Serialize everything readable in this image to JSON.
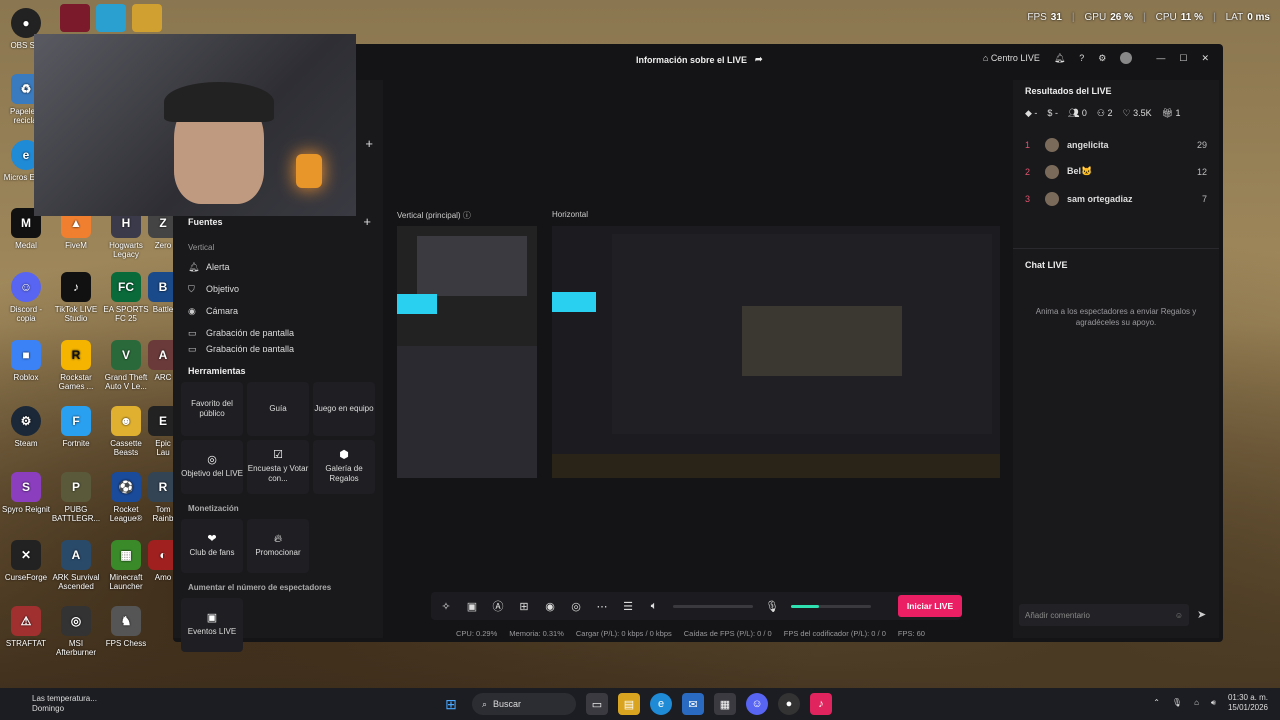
{
  "hud": {
    "fps_label": "FPS",
    "fps": "31",
    "gpu_label": "GPU",
    "gpu": "26 %",
    "cpu_label": "CPU",
    "cpu": "11 %",
    "lat_label": "LAT",
    "lat": "0 ms"
  },
  "desktop": {
    "icons": [
      "OBS Stu",
      "Papelera reciclaj",
      "Micros Edge",
      "Medal",
      "Discord - copia",
      "Roblox",
      "Steam",
      "Spyro Reignit",
      "CurseForge",
      "STRAFTAT",
      "FiveM",
      "TikTok LIVE Studio",
      "Rockstar Games ...",
      "Fortnite",
      "PUBG BATTLEGR...",
      "ARK Survival Ascended",
      "MSI Afterburner",
      "Hogwarts Legacy",
      "EA SPORTS FC 25",
      "Grand Theft Auto V Le...",
      "Cassette Beasts",
      "Rocket League®",
      "Minecraft Launcher",
      "FPS Chess",
      "Zero",
      "Battle",
      "ARC",
      "Epic Lau",
      "Tom Rainb",
      "Amo"
    ]
  },
  "window": {
    "title": "Información sobre el LIVE",
    "centro": "Centro LIVE"
  },
  "left": {
    "sources_title": "Fuentes",
    "vertical_label": "Vertical",
    "sources": [
      "Alerta",
      "Objetivo",
      "Cámara",
      "Grabación de pantalla",
      "Grabación de pantalla"
    ],
    "tools_title": "Herramientas",
    "tools": [
      {
        "label": "Favorito del público"
      },
      {
        "label": "Guía"
      },
      {
        "label": "Juego en equipo"
      },
      {
        "label": "Objetivo del LIVE"
      },
      {
        "label": "Encuesta y Votar con..."
      },
      {
        "label": "Galería de Regalos"
      }
    ],
    "monet_title": "Monetización",
    "monet": [
      {
        "label": "Club de fans"
      },
      {
        "label": "Promocionar"
      }
    ],
    "viewers_title": "Aumentar el número de espectadores",
    "viewers": [
      {
        "label": "Eventos LIVE"
      }
    ]
  },
  "preview": {
    "vertical": "Vertical (principal)",
    "horizontal": "Horizontal"
  },
  "results": {
    "title": "Resultados del LIVE",
    "stats": [
      "-",
      "-",
      "0",
      "2",
      "3.5K",
      "1"
    ],
    "ranking": [
      {
        "n": "1",
        "name": "angelicita",
        "v": "29"
      },
      {
        "n": "2",
        "name": "Bel🐱",
        "v": "12"
      },
      {
        "n": "3",
        "name": "sam ortegadiaz",
        "v": "7"
      }
    ]
  },
  "chat": {
    "title": "Chat LIVE",
    "empty": "Anima a los espectadores a enviar Regalos y agradéceles su apoyo.",
    "placeholder": "Añadir comentario"
  },
  "controls": {
    "go_live": "Iniciar LIVE",
    "status": [
      "CPU: 0.29%",
      "Memoria: 0.31%",
      "Cargar (P/L): 0 kbps / 0 kbps",
      "Caídas de FPS (P/L): 0 / 0",
      "FPS del codificador (P/L): 0 / 0",
      "FPS: 60"
    ],
    "mic_level": 0.35
  },
  "taskbar": {
    "weather_title": "Las temperatura...",
    "weather_sub": "Domingo",
    "search": "Buscar",
    "time": "01:30 a. m.",
    "date": "15/01/2026"
  }
}
